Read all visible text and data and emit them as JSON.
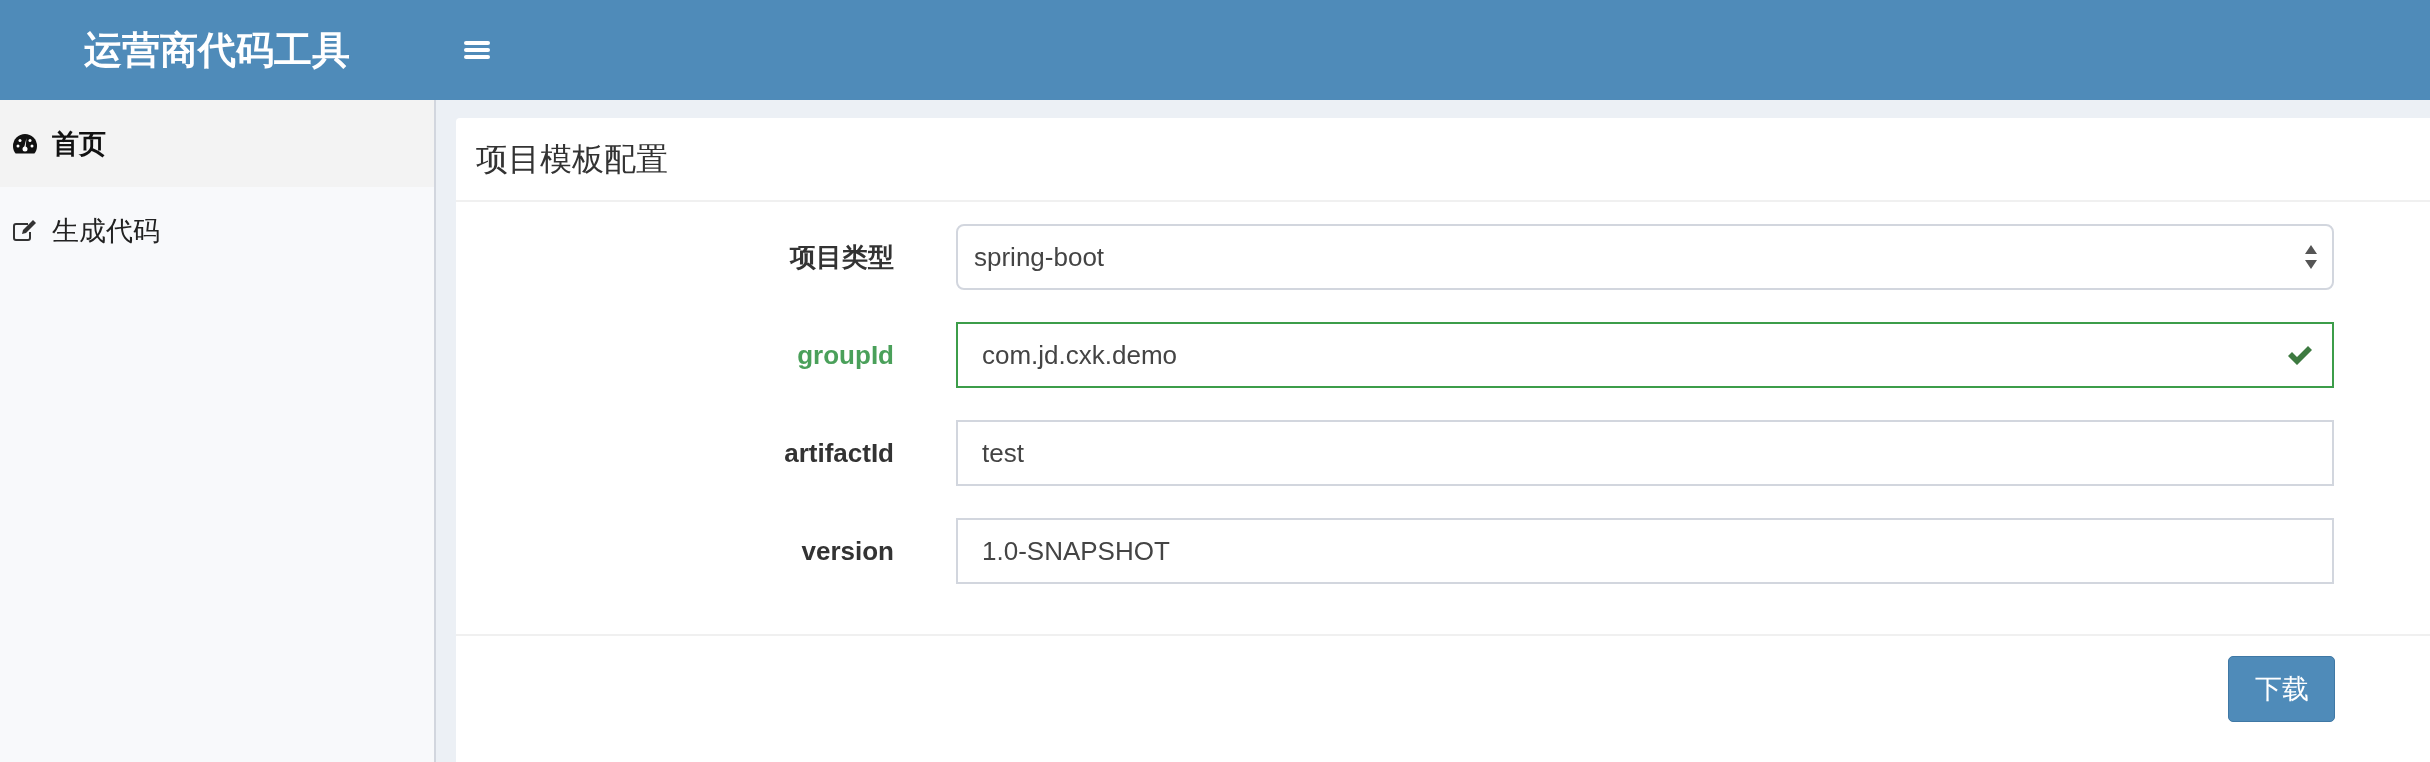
{
  "header": {
    "title": "运营商代码工具"
  },
  "sidebar": {
    "items": [
      {
        "label": "首页",
        "kind": "dashboard",
        "selected": true
      },
      {
        "label": "生成代码",
        "kind": "edit",
        "selected": false
      }
    ]
  },
  "card": {
    "title": "项目模板配置",
    "fields": [
      {
        "label": "项目类型",
        "kind": "select",
        "value": "spring-boot",
        "valid": false
      },
      {
        "label": "groupId",
        "kind": "text",
        "value": "com.jd.cxk.demo",
        "valid": true
      },
      {
        "label": "artifactId",
        "kind": "text",
        "value": "test",
        "valid": false
      },
      {
        "label": "version",
        "kind": "text",
        "value": "1.0-SNAPSHOT",
        "valid": false
      }
    ],
    "buttons": [
      {
        "label": "下载"
      }
    ]
  }
}
